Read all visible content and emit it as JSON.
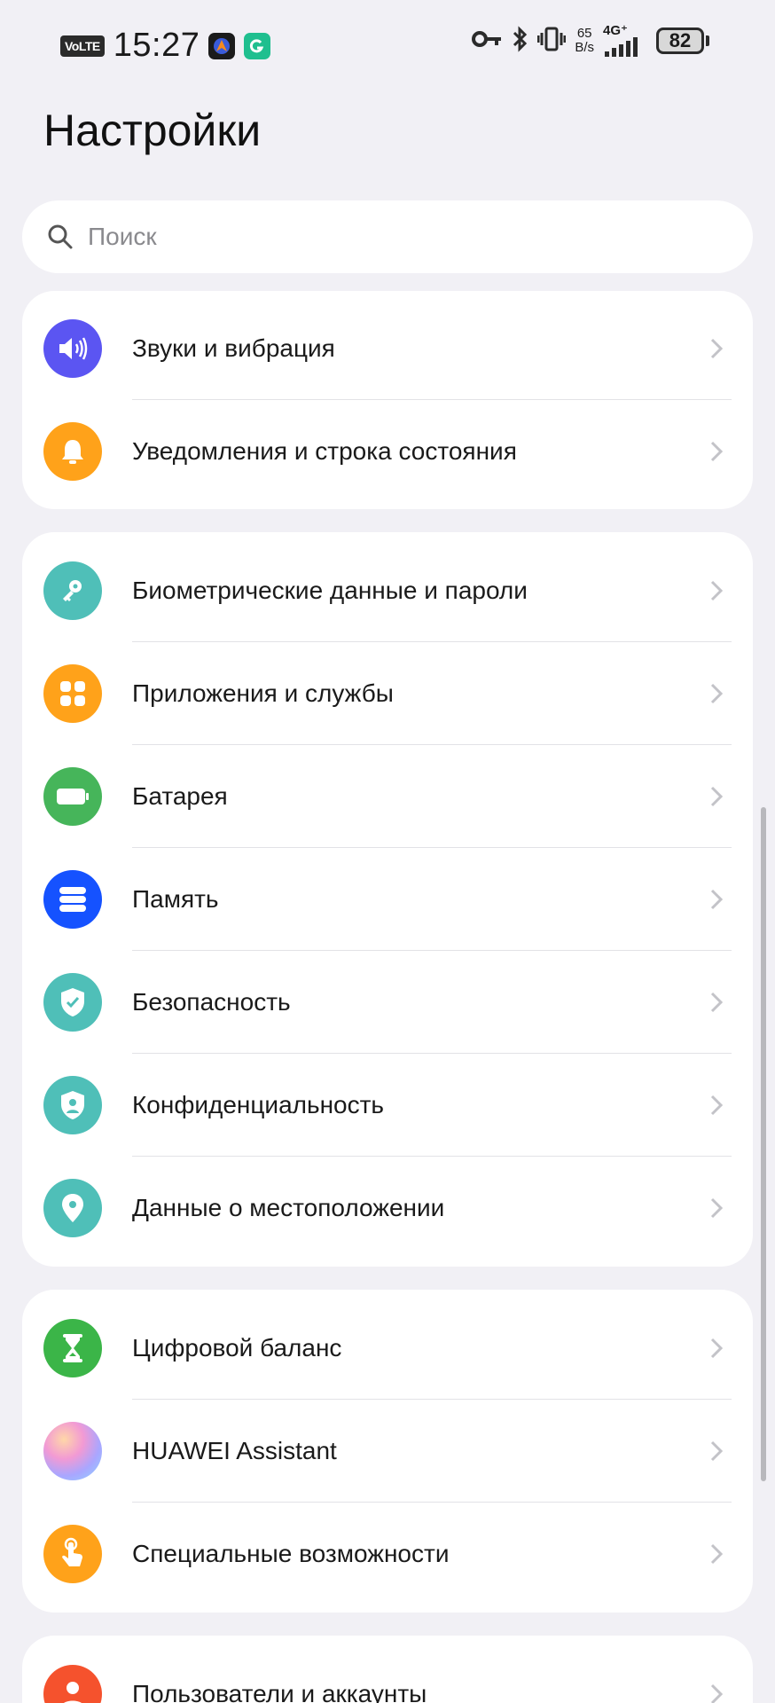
{
  "status_bar": {
    "volte": "VoLTE",
    "time": "15:27",
    "net_speed_value": "65",
    "net_speed_unit": "B/s",
    "network_type": "4G⁺",
    "battery_level": "82"
  },
  "page": {
    "title": "Настройки"
  },
  "search": {
    "placeholder": "Поиск"
  },
  "groups": [
    {
      "items": [
        {
          "label": "Звуки и вибрация",
          "icon": "speaker-icon",
          "color": "#5b55f2"
        },
        {
          "label": "Уведомления и строка состояния",
          "icon": "bell-icon",
          "color": "#ffa21a"
        }
      ]
    },
    {
      "items": [
        {
          "label": "Биометрические данные и пароли",
          "icon": "key-icon",
          "color": "#4fbfb8"
        },
        {
          "label": "Приложения и службы",
          "icon": "apps-grid-icon",
          "color": "#ffa21a"
        },
        {
          "label": "Батарея",
          "icon": "battery-icon",
          "color": "#46b55a"
        },
        {
          "label": "Память",
          "icon": "storage-icon",
          "color": "#1552ff"
        },
        {
          "label": "Безопасность",
          "icon": "shield-check-icon",
          "color": "#4fbfb8"
        },
        {
          "label": "Конфиденциальность",
          "icon": "privacy-shield-icon",
          "color": "#4fbfb8"
        },
        {
          "label": "Данные о местоположении",
          "icon": "location-pin-icon",
          "color": "#4fbfb8"
        }
      ]
    },
    {
      "items": [
        {
          "label": "Цифровой баланс",
          "icon": "hourglass-icon",
          "color": "#3bb548"
        },
        {
          "label": "HUAWEI Assistant",
          "icon": "huawei-assistant-icon",
          "color": "#d9b8f0"
        },
        {
          "label": "Специальные возможности",
          "icon": "hand-touch-icon",
          "color": "#ffa21a"
        }
      ]
    },
    {
      "items": [
        {
          "label": "Пользователи и аккаунты",
          "icon": "user-icon",
          "color": "#f5522d"
        }
      ]
    }
  ]
}
